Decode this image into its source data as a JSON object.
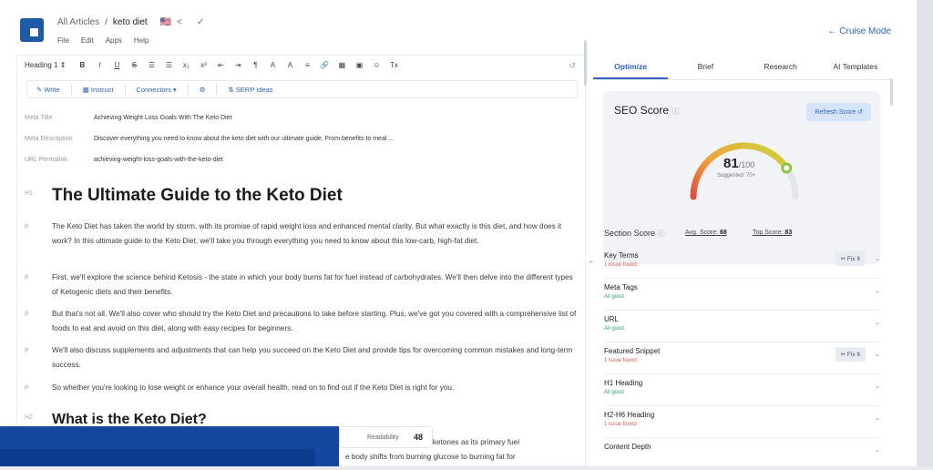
{
  "header": {
    "breadcrumb_root": "All Articles",
    "breadcrumb_sep": "/",
    "breadcrumb_current": "keto diet",
    "flag": "🇺🇸",
    "menu": [
      "File",
      "Edit",
      "Apps",
      "Help"
    ],
    "cruise_mode": "← Cruise Mode"
  },
  "toolbar": {
    "heading_select": "Heading 1 ⇕",
    "buttons": [
      "B",
      "I",
      "U",
      "S",
      "☰",
      "☰",
      "x₂",
      "x²",
      "⇤",
      "⇥",
      "¶",
      "A",
      "A",
      "≡",
      "🔗",
      "▦",
      "▣",
      "☺",
      "Tx"
    ],
    "history_icon": "↺"
  },
  "subtoolbar": {
    "write": "✎ Write",
    "instruct": "▦ Instruct",
    "connectors": "Connectors ▾",
    "settings_icon": "⚙",
    "serp_ideas": "⇅ SERP Ideas"
  },
  "meta": {
    "title_label": "Meta Title",
    "title_value": "Achieving Weight Loss Goals With The Keto Diet",
    "desc_label": "Meta Description",
    "desc_value": "Discover everything you need to know about the keto diet with our ultimate guide. From benefits to meal ...",
    "url_label": "URL Permalink",
    "url_value": "achieving-weight-loss-goals-with-the-keto-diet"
  },
  "content": {
    "h1_tag": "H1",
    "h1": "The Ultimate Guide to the Keto Diet",
    "p_tag": "P",
    "paragraphs": [
      "The Keto Diet has taken the world by storm, with its promise of rapid weight loss and enhanced mental clarity. But what exactly is this diet, and how does it work? In this ultimate guide to the Keto Diet, we'll take you through everything you need to know about this low-carb, high-fat diet.",
      "First, we'll explore the science behind Ketosis - the state in which your body burns fat for fuel instead of carbohydrates. We'll then delve into the different types of Ketogenic diets and their benefits.",
      "But that's not all. We'll also cover who should try the Keto Diet and precautions to take before starting. Plus, we've got you covered with a comprehensive list of foods to eat and avoid on this diet, along with easy recipes for beginners.",
      "We'll also discuss supplements and adjustments that can help you succeed on the Keto Diet and provide tips for overcoming common mistakes and long-term success.",
      "So whether you're looking to lose weight or enhance your overall health, read on to find out if the Keto Diet is right for you."
    ],
    "h2_tag": "H2",
    "h2": "What is the Keto Diet?",
    "partial_line1": "es ketones as its primary fuel",
    "partial_line2": "e body shifts from burning glucose to burning fat for"
  },
  "readability": {
    "label": "Readability",
    "value": "48"
  },
  "panel": {
    "tabs": [
      "Optimize",
      "Brief",
      "Research",
      "AI Templates"
    ],
    "seo": {
      "title": "SEO Score",
      "refresh": "Refresh Score ↺",
      "score": "81",
      "max": "/100",
      "suggested": "Suggested: 70+",
      "avg_label": "Avg. Score:",
      "avg_value": "68",
      "top_label": "Top Score:",
      "top_value": "83"
    },
    "section_score_title": "Section Score",
    "fix_label": "✂ Fix It",
    "sections": [
      {
        "name": "Key Terms",
        "status": "1 issue found",
        "state": "bad",
        "fix": true
      },
      {
        "name": "Meta Tags",
        "status": "All good",
        "state": "good",
        "fix": false
      },
      {
        "name": "URL",
        "status": "All good",
        "state": "good",
        "fix": false
      },
      {
        "name": "Featured Snippet",
        "status": "1 issue found",
        "state": "bad",
        "fix": true
      },
      {
        "name": "H1 Heading",
        "status": "All good",
        "state": "good",
        "fix": false
      },
      {
        "name": "H2-H6 Heading",
        "status": "1 issue found",
        "state": "bad",
        "fix": false
      },
      {
        "name": "Content Depth",
        "status": "",
        "state": "good",
        "fix": false
      }
    ]
  },
  "colors": {
    "accent": "#2d5fc4",
    "overlay_blue": "#1546a0",
    "bad": "#e05555",
    "good": "#2fa66b"
  }
}
